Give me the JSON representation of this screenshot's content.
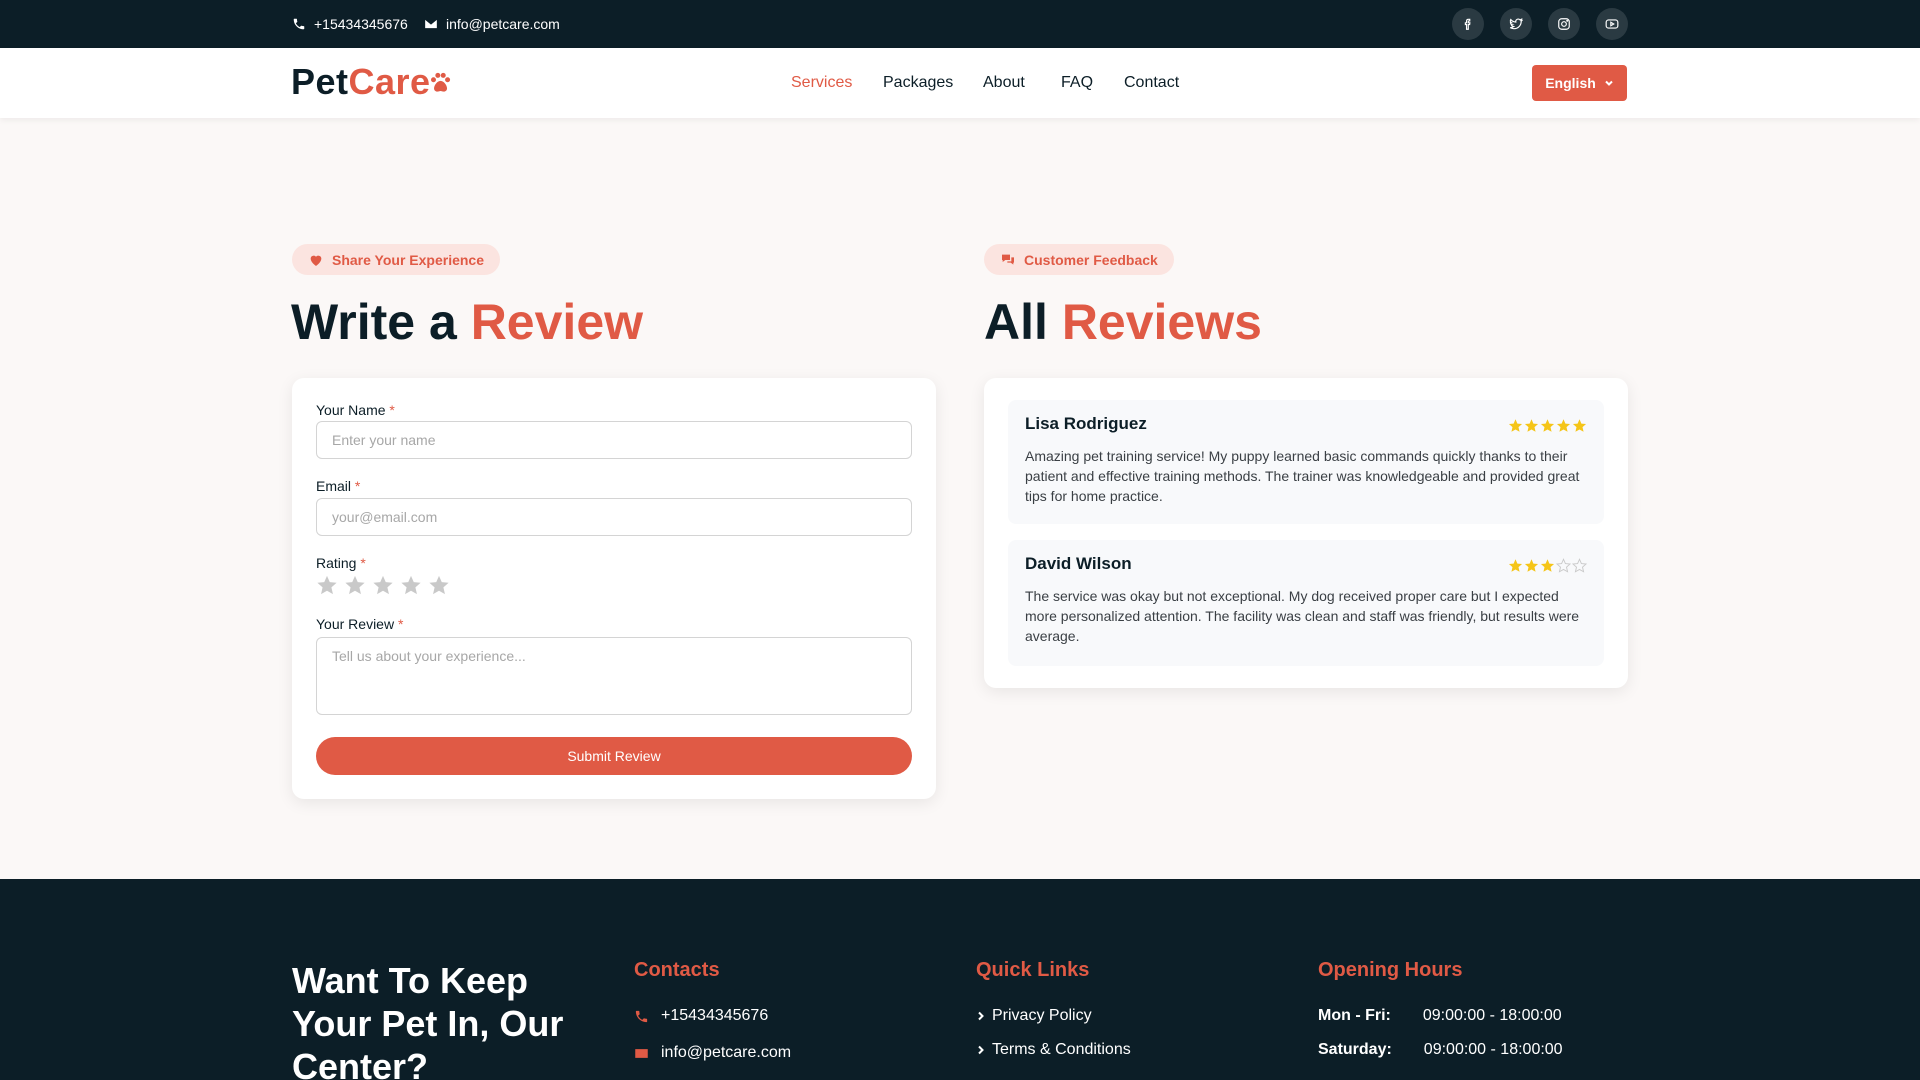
{
  "topbar": {
    "phone": "+15434345676",
    "email": "info@petcare.com",
    "socials": [
      "facebook-icon",
      "twitter-icon",
      "instagram-icon",
      "youtube-icon"
    ]
  },
  "header": {
    "logo_pet": "Pet",
    "logo_care": "Care",
    "nav": [
      "Services",
      "Packages",
      "About",
      "FAQ",
      "Contact"
    ],
    "active_nav": "Services",
    "language": "English"
  },
  "write_review": {
    "badge": "Share Your Experience",
    "title_main": "Write a",
    "title_accent": "Review",
    "name_label": "Your Name",
    "name_placeholder": "Enter your name",
    "email_label": "Email",
    "email_placeholder": "your@email.com",
    "rating_label": "Rating",
    "rating_value": 0,
    "review_label": "Your Review",
    "review_placeholder": "Tell us about your experience...",
    "required_mark": "*",
    "submit_label": "Submit Review"
  },
  "all_reviews": {
    "badge": "Customer Feedback",
    "title_main": "All",
    "title_accent": "Reviews",
    "items": [
      {
        "name": "Lisa Rodriguez",
        "rating": 5,
        "text": "Amazing pet training service! My puppy learned basic commands quickly thanks to their patient and effective training methods. The trainer was knowledgeable and provided great tips for home practice."
      },
      {
        "name": "David Wilson",
        "rating": 3,
        "text": "The service was okay but not exceptional. My dog received proper care but I expected more personalized attention. The facility was clean and staff was friendly, but results were average."
      }
    ]
  },
  "footer": {
    "hero": "Want To Keep Your Pet In, Our Center?",
    "contacts_title": "Contacts",
    "phone": "+15434345676",
    "email": "info@petcare.com",
    "links_title": "Quick Links",
    "links": [
      "Privacy Policy",
      "Terms & Conditions"
    ],
    "hours_title": "Opening Hours",
    "hours": [
      {
        "day": "Mon - Fri:",
        "time": "09:00:00 - 18:00:00"
      },
      {
        "day": "Saturday:",
        "time": "09:00:00 - 18:00:00"
      }
    ]
  },
  "colors": {
    "brand": "#e05a45",
    "dark": "#0c1e27",
    "star": "#f5c518",
    "star_empty": "#c9c9c9"
  }
}
